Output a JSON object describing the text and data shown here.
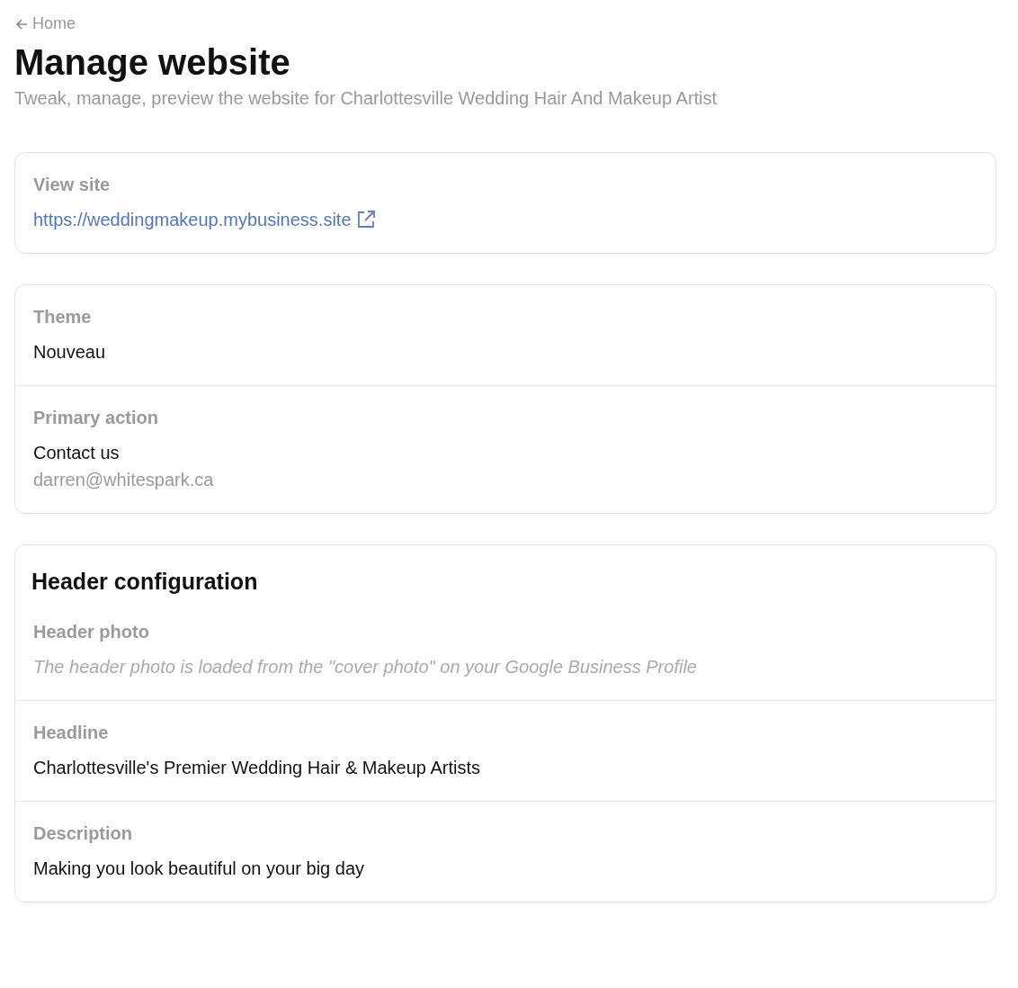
{
  "back_link": {
    "label": "Home"
  },
  "title": "Manage website",
  "subtitle": "Tweak, manage, preview the website for Charlottesville Wedding Hair And Makeup Artist",
  "cards": [
    {
      "sections": [
        {
          "label": "View site",
          "lines": [
            {
              "kind": "link",
              "text": "https://weddingmakeup.mybusiness.site"
            }
          ]
        }
      ]
    },
    {
      "sections": [
        {
          "label": "Theme",
          "lines": [
            {
              "kind": "value",
              "text": "Nouveau"
            }
          ]
        },
        {
          "label": "Primary action",
          "lines": [
            {
              "kind": "value",
              "text": "Contact us"
            },
            {
              "kind": "muted",
              "text": "darren@whitespark.ca"
            }
          ]
        }
      ]
    },
    {
      "heading": "Header configuration",
      "sections": [
        {
          "label": "Header photo",
          "lines": [
            {
              "kind": "note",
              "text": "The header photo is loaded from the \"cover photo\" on your Google Business Profile"
            }
          ]
        },
        {
          "label": "Headline",
          "lines": [
            {
              "kind": "value",
              "text": "Charlottesville's Premier Wedding Hair & Makeup Artists"
            }
          ]
        },
        {
          "label": "Description",
          "lines": [
            {
              "kind": "value",
              "text": "Making you look beautiful on your big day"
            }
          ]
        }
      ]
    }
  ]
}
